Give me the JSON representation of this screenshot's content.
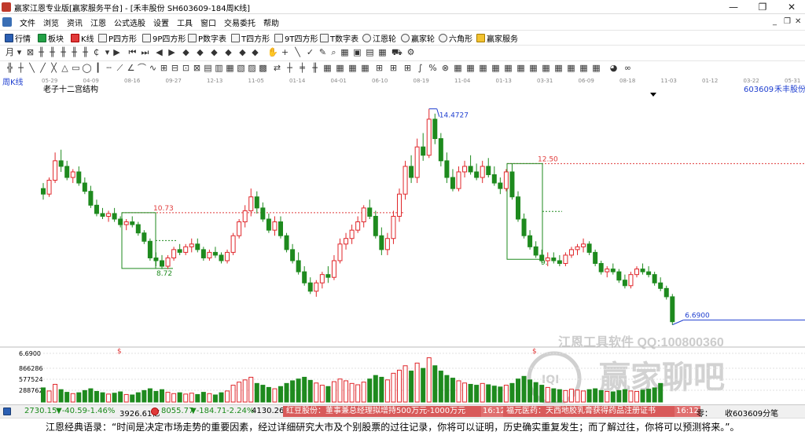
{
  "window": {
    "title": "赢家江恩专业版[赢家服务平台] - [禾丰股份  SH603609-184周K线]",
    "controls": [
      "—",
      "❐",
      "✕"
    ]
  },
  "menu": {
    "items": [
      "文件",
      "浏览",
      "资讯",
      "江恩",
      "公式选股",
      "设置",
      "工具",
      "窗口",
      "交易委托",
      "帮助"
    ]
  },
  "toolbar1": {
    "items": [
      "行情",
      "板块",
      "K线",
      "P四方形",
      "9P四方形",
      "P数字表",
      "T四方形",
      "9T四方形",
      "T数字表",
      "江恩轮",
      "赢家轮",
      "六角形",
      "赢家服务"
    ]
  },
  "chart": {
    "period_label": "周K线",
    "indicator_name": "老子十二宫结构",
    "stock_code": "603609",
    "stock_name": "禾丰股份",
    "date_ticks": [
      "05-29",
      "04-09",
      "08-16",
      "09-27",
      "12-13",
      "11-05",
      "01-14",
      "04-01",
      "06-10",
      "08-19",
      "11-04",
      "01-13",
      "03-31",
      "06-09",
      "08-18",
      "11-03",
      "01-12",
      "03-22",
      "05-31",
      "08-08"
    ],
    "price_annotations": {
      "high": "14.4727",
      "low": "6.6900",
      "level_left": "10.73",
      "level_right": "12.50",
      "box_left_low": "8.72",
      "box_right_low": "9."
    },
    "volume_axis_labels": [
      "6.6900",
      "866286",
      "577524",
      "288762"
    ],
    "marker_symbol": "$",
    "watermark_text": "江恩工具软件  QQ:100800360",
    "watermark_logo_text": "赢家聊吧",
    "watermark_logo_badge": "IQI"
  },
  "chart_data": {
    "type": "candlestick",
    "title": "老子十二宫结构",
    "y_range": [
      6.0,
      15.0
    ],
    "volume_range": [
      0,
      1100000
    ],
    "marked_levels": [
      10.73,
      12.5
    ],
    "marked_high": 14.4727,
    "marked_low": 6.69,
    "ohlc": [
      [
        11.6,
        11.8,
        11.2,
        11.4
      ],
      [
        11.4,
        12.0,
        11.3,
        11.9
      ],
      [
        11.9,
        12.9,
        11.8,
        12.6
      ],
      [
        12.6,
        13.0,
        12.2,
        12.4
      ],
      [
        12.4,
        12.6,
        11.9,
        12.0
      ],
      [
        12.0,
        12.3,
        11.8,
        12.2
      ],
      [
        12.2,
        12.4,
        11.7,
        11.8
      ],
      [
        11.8,
        12.0,
        11.4,
        11.5
      ],
      [
        11.5,
        11.7,
        10.9,
        11.0
      ],
      [
        11.0,
        11.2,
        10.6,
        10.7
      ],
      [
        10.7,
        10.9,
        10.5,
        10.6
      ],
      [
        10.6,
        10.8,
        10.4,
        10.7
      ],
      [
        10.7,
        10.9,
        10.4,
        10.5
      ],
      [
        10.5,
        10.6,
        10.2,
        10.3
      ],
      [
        10.3,
        10.5,
        10.1,
        10.4
      ],
      [
        10.4,
        10.6,
        10.2,
        10.3
      ],
      [
        10.3,
        10.4,
        9.9,
        10.0
      ],
      [
        10.0,
        10.1,
        9.6,
        9.7
      ],
      [
        9.7,
        9.8,
        9.0,
        9.1
      ],
      [
        9.1,
        9.3,
        8.8,
        9.0
      ],
      [
        9.0,
        9.2,
        8.7,
        8.8
      ],
      [
        8.8,
        9.2,
        8.7,
        9.1
      ],
      [
        9.1,
        9.5,
        9.0,
        9.4
      ],
      [
        9.4,
        9.6,
        9.2,
        9.3
      ],
      [
        9.3,
        9.6,
        9.2,
        9.5
      ],
      [
        9.5,
        9.8,
        9.3,
        9.6
      ],
      [
        9.6,
        9.8,
        9.3,
        9.4
      ],
      [
        9.4,
        9.5,
        9.0,
        9.1
      ],
      [
        9.1,
        9.4,
        9.0,
        9.3
      ],
      [
        9.3,
        9.5,
        9.1,
        9.2
      ],
      [
        9.2,
        9.3,
        8.9,
        9.0
      ],
      [
        9.0,
        9.4,
        8.9,
        9.3
      ],
      [
        9.3,
        10.0,
        9.2,
        9.9
      ],
      [
        9.9,
        10.5,
        9.8,
        10.4
      ],
      [
        10.4,
        11.0,
        10.2,
        10.8
      ],
      [
        10.8,
        11.6,
        10.6,
        11.3
      ],
      [
        11.3,
        11.5,
        10.7,
        10.9
      ],
      [
        10.9,
        11.1,
        10.4,
        10.5
      ],
      [
        10.5,
        10.7,
        10.0,
        10.1
      ],
      [
        10.1,
        10.6,
        9.9,
        10.4
      ],
      [
        10.4,
        10.6,
        9.8,
        9.9
      ],
      [
        9.9,
        10.0,
        9.3,
        9.4
      ],
      [
        9.4,
        9.6,
        8.9,
        9.0
      ],
      [
        9.0,
        9.3,
        8.5,
        8.6
      ],
      [
        8.6,
        8.8,
        8.1,
        8.2
      ],
      [
        8.2,
        8.4,
        7.8,
        7.9
      ],
      [
        7.9,
        8.3,
        7.7,
        8.2
      ],
      [
        8.2,
        8.6,
        8.0,
        8.5
      ],
      [
        8.5,
        8.8,
        8.2,
        8.4
      ],
      [
        8.4,
        9.2,
        8.3,
        9.0
      ],
      [
        9.0,
        9.8,
        8.9,
        9.6
      ],
      [
        9.6,
        10.0,
        9.4,
        9.8
      ],
      [
        9.8,
        10.3,
        9.6,
        10.1
      ],
      [
        10.1,
        10.6,
        10.0,
        10.4
      ],
      [
        10.4,
        11.0,
        10.2,
        10.9
      ],
      [
        10.9,
        11.2,
        10.5,
        10.6
      ],
      [
        10.6,
        10.8,
        9.8,
        9.9
      ],
      [
        9.9,
        10.2,
        9.2,
        9.4
      ],
      [
        9.4,
        10.0,
        9.2,
        9.8
      ],
      [
        9.8,
        10.8,
        9.6,
        10.6
      ],
      [
        10.6,
        11.6,
        10.4,
        11.4
      ],
      [
        11.4,
        12.6,
        11.2,
        12.4
      ],
      [
        12.4,
        12.8,
        11.8,
        12.0
      ],
      [
        12.0,
        13.4,
        11.8,
        13.1
      ],
      [
        13.1,
        13.6,
        12.6,
        12.8
      ],
      [
        12.8,
        14.4727,
        12.7,
        14.1
      ],
      [
        14.1,
        14.3,
        13.2,
        13.4
      ],
      [
        13.4,
        13.6,
        12.4,
        12.6
      ],
      [
        12.6,
        12.9,
        11.8,
        12.0
      ],
      [
        12.0,
        12.3,
        11.5,
        11.6
      ],
      [
        11.6,
        12.4,
        11.5,
        12.2
      ],
      [
        12.2,
        12.6,
        12.0,
        12.4
      ],
      [
        12.4,
        12.8,
        12.1,
        12.2
      ],
      [
        12.2,
        12.5,
        11.9,
        12.0
      ],
      [
        12.0,
        12.6,
        11.8,
        12.4
      ],
      [
        12.4,
        12.7,
        12.0,
        12.1
      ],
      [
        12.1,
        12.4,
        11.7,
        11.8
      ],
      [
        11.8,
        12.0,
        11.4,
        11.6
      ],
      [
        11.6,
        12.3,
        11.5,
        12.2
      ],
      [
        12.2,
        12.5,
        11.2,
        11.3
      ],
      [
        11.3,
        11.5,
        10.4,
        10.5
      ],
      [
        10.5,
        10.7,
        9.8,
        9.9
      ],
      [
        9.9,
        10.1,
        9.4,
        9.5
      ],
      [
        9.5,
        9.7,
        9.1,
        9.2
      ],
      [
        9.2,
        9.4,
        8.9,
        9.0
      ],
      [
        9.0,
        9.3,
        8.8,
        9.1
      ],
      [
        9.1,
        9.3,
        8.9,
        9.0
      ],
      [
        9.0,
        9.2,
        8.8,
        8.9
      ],
      [
        8.9,
        9.3,
        8.8,
        9.2
      ],
      [
        9.2,
        9.5,
        9.1,
        9.4
      ],
      [
        9.4,
        9.6,
        9.2,
        9.5
      ],
      [
        9.5,
        9.8,
        9.3,
        9.6
      ],
      [
        9.6,
        9.7,
        9.2,
        9.3
      ],
      [
        9.3,
        9.4,
        8.8,
        8.9
      ],
      [
        8.9,
        9.0,
        8.5,
        8.6
      ],
      [
        8.6,
        8.8,
        8.4,
        8.7
      ],
      [
        8.7,
        8.9,
        8.5,
        8.6
      ],
      [
        8.6,
        8.7,
        8.2,
        8.3
      ],
      [
        8.3,
        8.5,
        8.0,
        8.1
      ],
      [
        8.1,
        8.6,
        8.0,
        8.5
      ],
      [
        8.5,
        8.8,
        8.4,
        8.7
      ],
      [
        8.7,
        8.9,
        8.5,
        8.6
      ],
      [
        8.6,
        8.8,
        8.4,
        8.5
      ],
      [
        8.5,
        8.6,
        8.1,
        8.2
      ],
      [
        8.2,
        8.4,
        7.9,
        8.0
      ],
      [
        8.0,
        8.1,
        7.6,
        7.7
      ],
      [
        7.7,
        7.8,
        6.69,
        6.8
      ]
    ],
    "volume": [
      320000,
      250000,
      400000,
      280000,
      220000,
      190000,
      210000,
      260000,
      300000,
      240000,
      210000,
      180000,
      200000,
      230000,
      170000,
      160000,
      210000,
      260000,
      300000,
      240000,
      280000,
      220000,
      190000,
      210000,
      180000,
      200000,
      170000,
      220000,
      190000,
      160000,
      210000,
      250000,
      380000,
      450000,
      500000,
      560000,
      420000,
      380000,
      330000,
      300000,
      350000,
      420000,
      480000,
      520000,
      560000,
      490000,
      430000,
      380000,
      350000,
      460000,
      520000,
      480000,
      420000,
      390000,
      450000,
      520000,
      600000,
      560000,
      500000,
      650000,
      720000,
      820000,
      700000,
      880000,
      760000,
      1000000,
      820000,
      700000,
      600000,
      540000,
      480000,
      430000,
      400000,
      380000,
      420000,
      390000,
      360000,
      340000,
      380000,
      420000,
      520000,
      580000,
      500000,
      440000,
      380000,
      330000,
      300000,
      280000,
      260000,
      290000,
      270000,
      250000,
      280000,
      300000,
      260000,
      240000,
      230000,
      260000,
      280000,
      250000,
      240000,
      270000,
      290000,
      320000,
      420000
    ]
  },
  "statusbar": {
    "index1_value": "2730.15",
    "index1_change": "▼-40.59",
    "index1_pct": "-1.46%",
    "index1_amount": "3926.61亿",
    "index2_value": "8055.77",
    "index2_change": "▼-184.71",
    "index2_pct": "-2.24%",
    "index2_amount": "4130.26",
    "news1": "红豆股份：董事兼总经理拟增持500万元-1000万元",
    "news1_time": "16:12",
    "news2": "福元医药：天西地胶乳膏获得药品注册证书",
    "news2_time": "16:12",
    "right_label": "零：",
    "right_text": "收603609分笔"
  },
  "quote": {
    "text": "江恩经典语录：“时间是决定市场走势的重要因素，经过详细研究大市及个别股票的过往记录，你将可以证明，历史确实重复发生；而了解过往，你将可以预测将来。”。"
  },
  "colors": {
    "up": "#e0262a",
    "down": "#1e8a1e",
    "level_line": "#e03a3a",
    "box_line": "#1e8a1e",
    "annotation_blue": "#1f3fd0",
    "status_down": "#1a8a1a",
    "watermark": "#c8c8c8"
  }
}
